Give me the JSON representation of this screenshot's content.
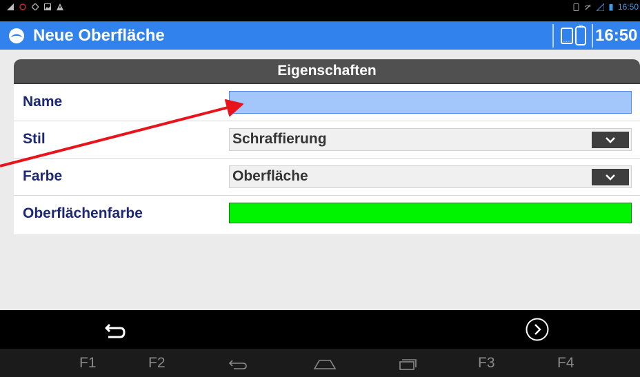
{
  "statusbar": {
    "time": "16:50"
  },
  "appbar": {
    "title": "Neue Oberfläche",
    "clock": "16:50"
  },
  "panel": {
    "header": "Eigenschaften",
    "rows": [
      {
        "label": "Name",
        "value": ""
      },
      {
        "label": "Stil",
        "value": "Schraffierung"
      },
      {
        "label": "Farbe",
        "value": "Oberfläche"
      },
      {
        "label": "Oberflächenfarbe",
        "color": "#00f400"
      }
    ]
  },
  "navbar": {
    "keys": [
      "F1",
      "F2",
      "F3",
      "F4"
    ]
  },
  "colors": {
    "appbar": "#3182ec",
    "label": "#1d2874",
    "input_focus": "#a3c6fb",
    "annotation_arrow": "#e8141b"
  }
}
